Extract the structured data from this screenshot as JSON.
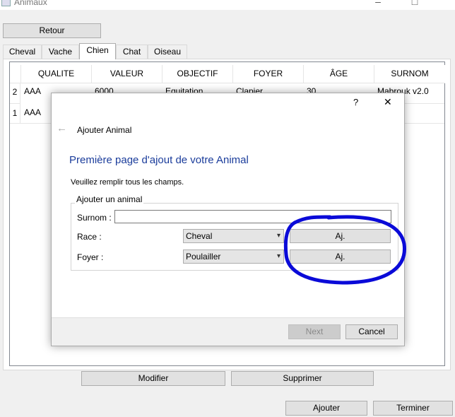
{
  "window": {
    "title": "Animaux"
  },
  "top": {
    "back_label": "Retour"
  },
  "tabs": [
    "Cheval",
    "Vache",
    "Chien",
    "Chat",
    "Oiseau"
  ],
  "table": {
    "columns": [
      "QUALITE",
      "VALEUR",
      "OBJECTIF",
      "FOYER",
      "ÂGE",
      "SURNOM"
    ],
    "rows": [
      {
        "id": "2",
        "qualite": "AAA",
        "valeur": "6000",
        "objectif": "Equitation",
        "foyer": "Clapier",
        "age": "30",
        "surnom": "Mabrouk v2.0"
      },
      {
        "id": "1",
        "qualite": "AAA"
      }
    ]
  },
  "dialog": {
    "help_glyph": "?",
    "close_glyph": "✕",
    "back_glyph": "←",
    "wizard_title": "Ajouter Animal",
    "page_title": "Première page d'ajout de votre Animal",
    "subtitle": "Veuillez remplir tous les champs.",
    "group_title": "Ajouter un animal",
    "surnom_label": "Surnom :",
    "surnom_value": "",
    "race_label": "Race :",
    "race_value": "Cheval",
    "race_add": "Aj.",
    "foyer_label": "Foyer :",
    "foyer_value": "Poulailler",
    "foyer_add": "Aj.",
    "next_label": "Next",
    "cancel_label": "Cancel"
  },
  "bottom": {
    "modify_label": "Modifier",
    "delete_label": "Supprimer",
    "add_label": "Ajouter",
    "finish_label": "Terminer"
  },
  "annotation": {
    "color": "#0a0ad8"
  }
}
